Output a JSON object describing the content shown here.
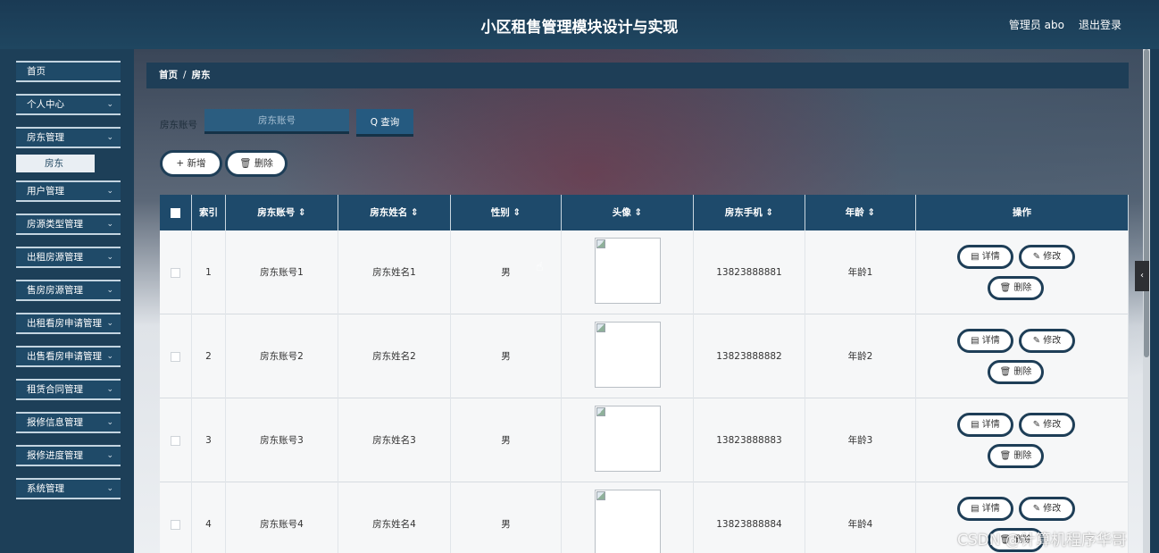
{
  "header": {
    "title": "小区租售管理模块设计与实现",
    "user_label": "管理员 abo",
    "logout": "退出登录"
  },
  "sidebar": {
    "items": [
      {
        "label": "首页",
        "has_arrow": false
      },
      {
        "label": "个人中心",
        "has_arrow": true
      },
      {
        "label": "房东管理",
        "has_arrow": true
      },
      {
        "label": "用户管理",
        "has_arrow": true
      },
      {
        "label": "房源类型管理",
        "has_arrow": true
      },
      {
        "label": "出租房源管理",
        "has_arrow": true
      },
      {
        "label": "售房房源管理",
        "has_arrow": true
      },
      {
        "label": "出租看房申请管理",
        "has_arrow": true
      },
      {
        "label": "出售看房申请管理",
        "has_arrow": true
      },
      {
        "label": "租赁合同管理",
        "has_arrow": true
      },
      {
        "label": "报修信息管理",
        "has_arrow": true
      },
      {
        "label": "报修进度管理",
        "has_arrow": true
      },
      {
        "label": "系统管理",
        "has_arrow": true
      }
    ],
    "sub_item": "房东",
    "chevron": "⌄"
  },
  "breadcrumb": {
    "home": "首页",
    "sep": "/",
    "current": "房东"
  },
  "search": {
    "label": "房东账号",
    "placeholder": "房东账号",
    "button": "Q 查询"
  },
  "actions": {
    "add": "+ 新增",
    "delete": "🗑 删除"
  },
  "table": {
    "headers": [
      "",
      "索引",
      "房东账号 ⇕",
      "房东姓名 ⇕",
      "性别 ⇕",
      "头像 ⇕",
      "房东手机 ⇕",
      "年龄 ⇕",
      "操作"
    ],
    "rows": [
      {
        "index": "1",
        "account": "房东账号1",
        "name": "房东姓名1",
        "gender": "男",
        "phone": "13823888881",
        "age": "年龄1"
      },
      {
        "index": "2",
        "account": "房东账号2",
        "name": "房东姓名2",
        "gender": "男",
        "phone": "13823888882",
        "age": "年龄2"
      },
      {
        "index": "3",
        "account": "房东账号3",
        "name": "房东姓名3",
        "gender": "男",
        "phone": "13823888883",
        "age": "年龄3"
      },
      {
        "index": "4",
        "account": "房东账号4",
        "name": "房东姓名4",
        "gender": "男",
        "phone": "13823888884",
        "age": "年龄4"
      }
    ],
    "op_detail": "▤ 详情",
    "op_edit": "✎ 修改",
    "op_delete": "🗑 删除"
  },
  "right_tab": "‹",
  "watermark": "CSDN @计算机程序华哥"
}
